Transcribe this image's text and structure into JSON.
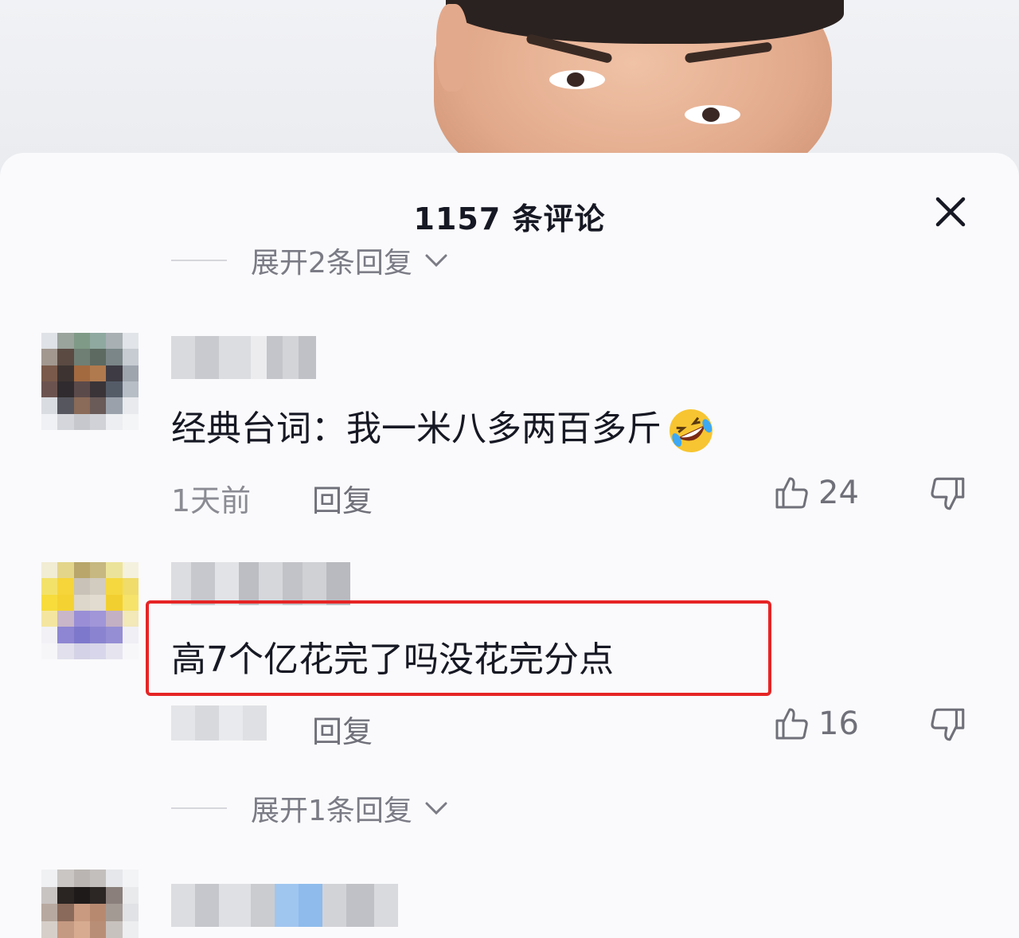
{
  "sheet": {
    "title": "1157 条评论",
    "close_icon": "close-icon"
  },
  "expand_top": {
    "label": "展开2条回复"
  },
  "comments": [
    {
      "text": "经典台词：我一米八多两百多斤",
      "emoji": "rolling-on-floor-laughing-emoji",
      "time": "1天前",
      "reply_label": "回复",
      "likes": "24"
    },
    {
      "text": "高7个亿花完了吗没花完分点",
      "time": "",
      "reply_label": "回复",
      "likes": "16"
    }
  ],
  "expand_bottom": {
    "label": "展开1条回复"
  },
  "colors": {
    "highlight_border": "#e62425",
    "text_primary": "#161823",
    "text_secondary": "#8a8b93"
  }
}
